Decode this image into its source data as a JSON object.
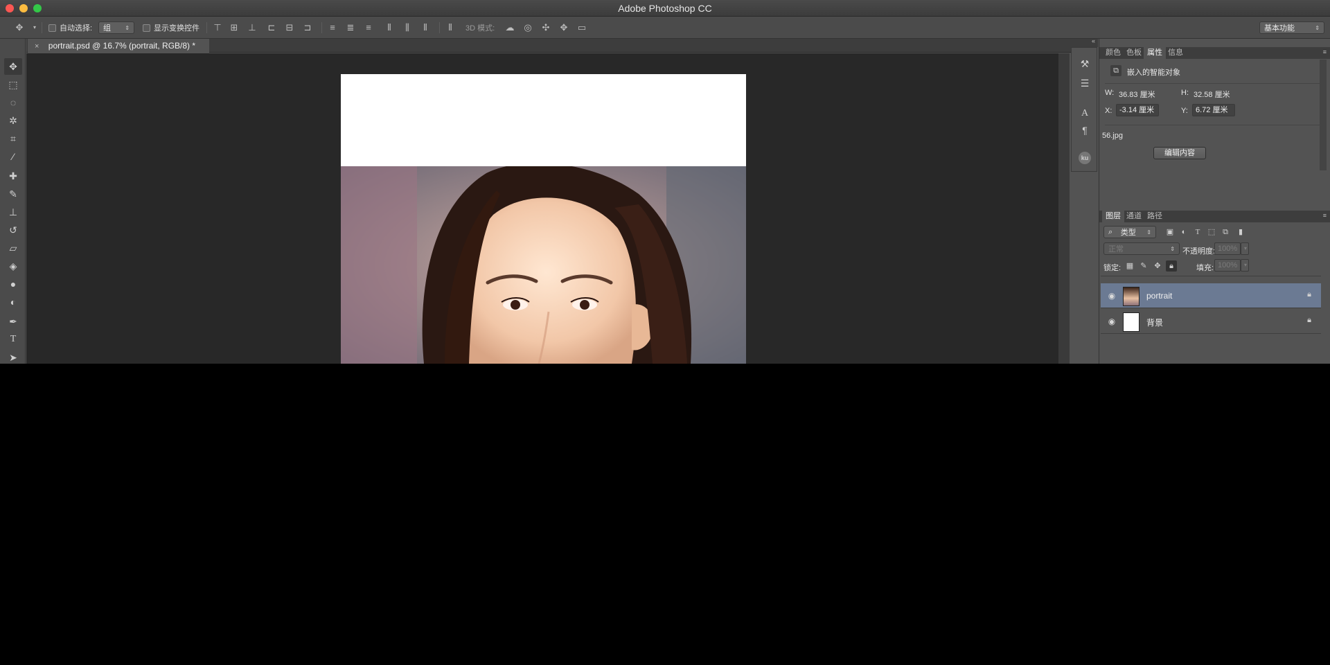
{
  "window": {
    "title": "Adobe Photoshop CC"
  },
  "options_bar": {
    "auto_select_label": "自动选择:",
    "auto_select_value": "组",
    "show_transform_label": "显示变换控件",
    "mode_3d_label": "3D 模式:",
    "workspace_value": "基本功能"
  },
  "document": {
    "tab_title": "portrait.psd @ 16.7% (portrait, RGB/8) *",
    "close_glyph": "×"
  },
  "properties_panel": {
    "tabs": [
      {
        "label": "颜色"
      },
      {
        "label": "色板"
      },
      {
        "label": "属性"
      },
      {
        "label": "信息"
      }
    ],
    "header": "嵌入的智能对象",
    "w_label": "W:",
    "w_value": "36.83 厘米",
    "h_label": "H:",
    "h_value": "32.58 厘米",
    "x_label": "X:",
    "x_value": "-3.14 厘米",
    "y_label": "Y:",
    "y_value": "6.72 厘米",
    "file_name": "56.jpg",
    "edit_button": "编辑内容"
  },
  "layers_panel": {
    "tabs": [
      {
        "label": "图层"
      },
      {
        "label": "通道"
      },
      {
        "label": "路径"
      }
    ],
    "filter_value": "类型",
    "blend_mode": "正常",
    "opacity_label": "不透明度:",
    "opacity_value": "100%",
    "lock_label": "锁定:",
    "fill_label": "填充:",
    "fill_value": "100%",
    "layers": [
      {
        "name": "portrait",
        "selected": true
      },
      {
        "name": "背景",
        "selected": false
      }
    ]
  },
  "colors": {
    "selected_layer": "#6b7a93",
    "panel_bg": "#535353",
    "canvas_bg": "#282828"
  }
}
